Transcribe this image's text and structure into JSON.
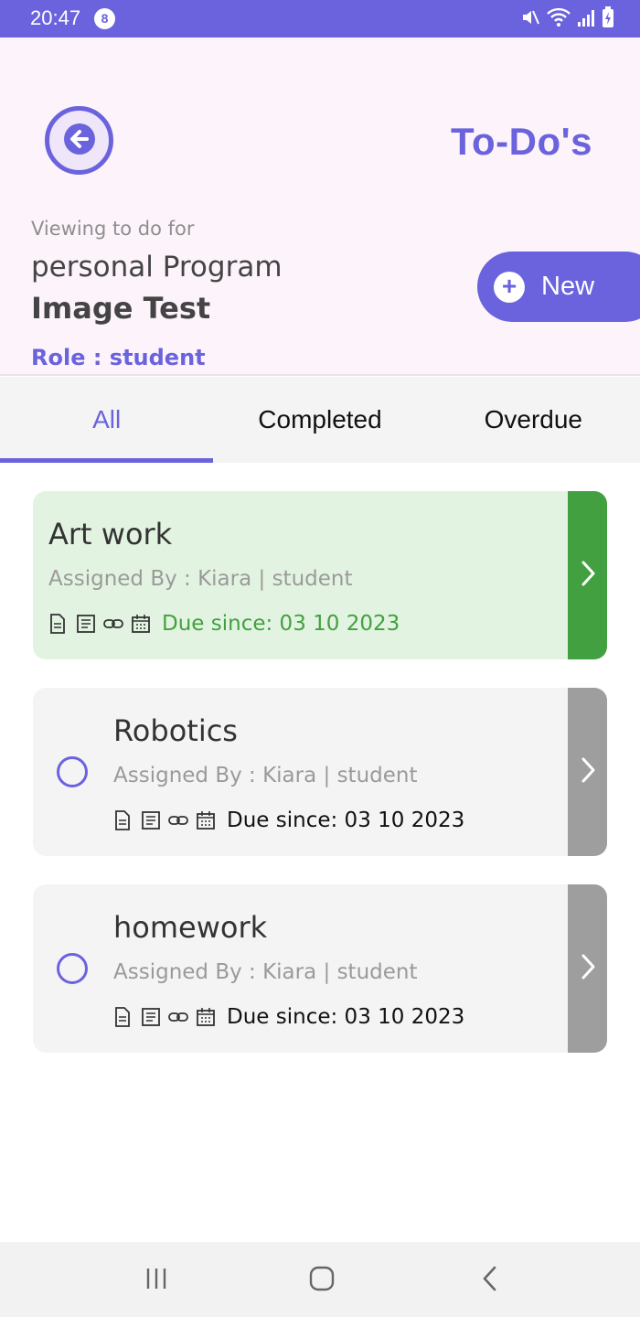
{
  "status_bar": {
    "time": "20:47",
    "notification_count": "8",
    "icons": [
      "mute-icon",
      "wifi-icon",
      "signal-icon",
      "battery-charging-icon"
    ]
  },
  "header": {
    "back_icon": "arrow-left-icon",
    "title": "To-Do's",
    "viewing_label": "Viewing to do for",
    "program_name": "personal Program",
    "program_sub": "Image Test",
    "role": "Role : student",
    "new_button": {
      "icon": "plus-icon",
      "label": "New"
    }
  },
  "tabs": [
    {
      "label": "All",
      "active": true
    },
    {
      "label": "Completed",
      "active": false
    },
    {
      "label": "Overdue",
      "active": false
    }
  ],
  "todos": [
    {
      "title": "Art work",
      "assigned": "Assigned By : Kiara | student",
      "due": "Due since: 03 10 2023",
      "completed": true
    },
    {
      "title": "Robotics",
      "assigned": "Assigned By : Kiara | student",
      "due": "Due since: 03 10 2023",
      "completed": false
    },
    {
      "title": "homework",
      "assigned": "Assigned By : Kiara | student",
      "due": "Due since: 03 10 2023",
      "completed": false
    }
  ],
  "colors": {
    "accent": "#6b63dd",
    "complete": "#43a040",
    "header_bg": "#fdf4fb",
    "card_bg": "#f4f4f4",
    "card_done_bg": "#e2f4e1"
  },
  "nav_bar": {
    "icons": [
      "recent-apps-icon",
      "home-icon",
      "back-nav-icon"
    ]
  }
}
